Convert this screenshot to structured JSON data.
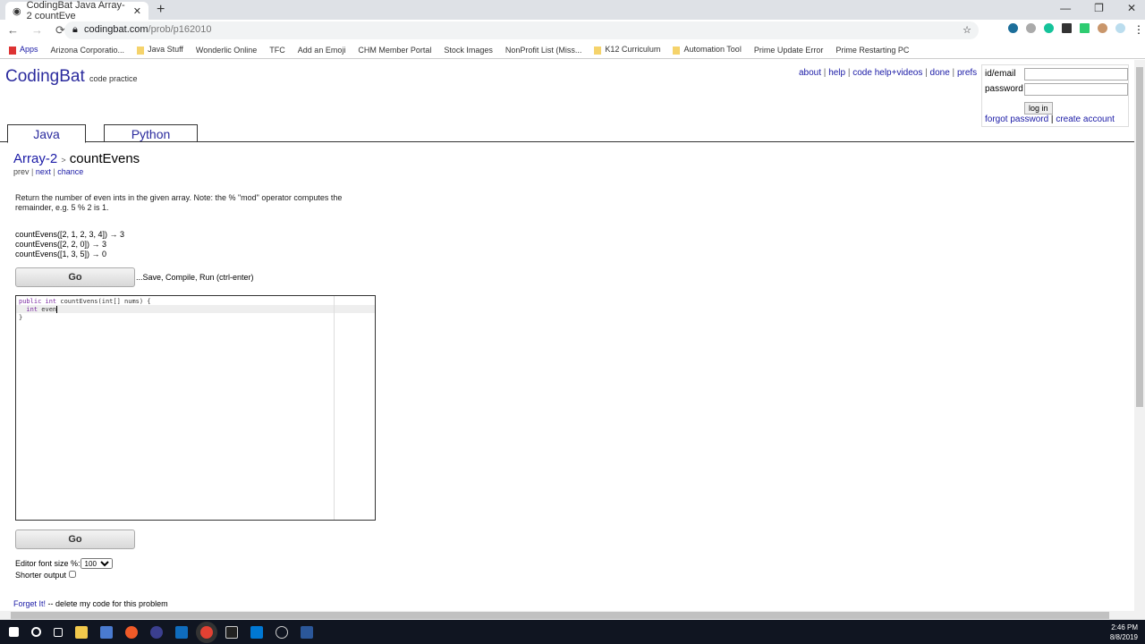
{
  "browser": {
    "tab_title": "CodingBat Java Array-2 countEve",
    "url_host": "codingbat.com",
    "url_path": "/prob/p162010",
    "bookmarks": [
      "Apps",
      "Arizona Corporatio...",
      "Java Stuff",
      "Wonderlic Online",
      "TFC",
      "Add an Emoji",
      "CHM Member Portal",
      "Stock Images",
      "NonProfit List (Miss...",
      "K12 Curriculum",
      "Automation Tool",
      "Prime Update Error",
      "Prime Restarting PC"
    ]
  },
  "site": {
    "logo": "CodingBat",
    "tagline": "code practice",
    "links": [
      "about",
      "help",
      "code help+videos",
      "done",
      "prefs"
    ],
    "login": {
      "id_label": "id/email",
      "password_label": "password",
      "button": "log in",
      "forgot": "forgot password",
      "create": "create account"
    },
    "tabs": [
      "Java",
      "Python"
    ]
  },
  "problem": {
    "category": "Array-2",
    "name": "countEvens",
    "prev": "prev",
    "next": "next",
    "chance": "chance",
    "description": "Return the number of even ints in the given array. Note: the % \"mod\" operator computes the remainder, e.g. 5 % 2 is 1.",
    "examples": [
      "countEvens([2, 1, 2, 3, 4]) → 3",
      "countEvens([2, 2, 0]) → 3",
      "countEvens([1, 3, 5]) → 0"
    ],
    "go": "Go",
    "hint": "...Save, Compile, Run (ctrl-enter)",
    "code": {
      "line1_kw": "public int",
      "line1_rest": " countEvens(int[] nums) {",
      "line2_kw": "  int",
      "line2_rest": " even",
      "line3": "}"
    },
    "font_size_label": "Editor font size %:",
    "font_size_value": "100",
    "shorter_output": "Shorter output",
    "forget_link": "Forget It!",
    "forget_text": " -- delete my code for this problem"
  },
  "taskbar": {
    "time": "2:46 PM",
    "date": "8/8/2019"
  }
}
